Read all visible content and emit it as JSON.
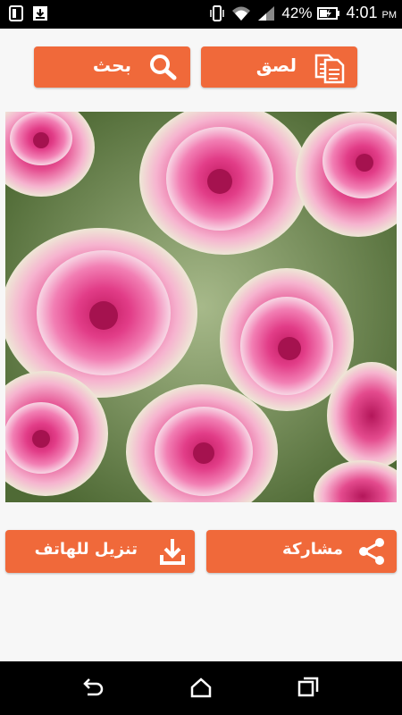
{
  "status_bar": {
    "battery_percent": "42%",
    "time": "4:01",
    "ampm": "PM"
  },
  "toolbar": {
    "search_label": "بحث",
    "paste_label": "لصق"
  },
  "image": {
    "subject": "pink roses"
  },
  "actions": {
    "download_label": "تنزيل للهاتف",
    "share_label": "مشاركة"
  },
  "colors": {
    "accent": "#f0693a",
    "background": "#f7f7f7"
  },
  "icons": {
    "search": "search-icon",
    "paste": "paste-icon",
    "download": "download-icon",
    "share": "share-icon"
  }
}
